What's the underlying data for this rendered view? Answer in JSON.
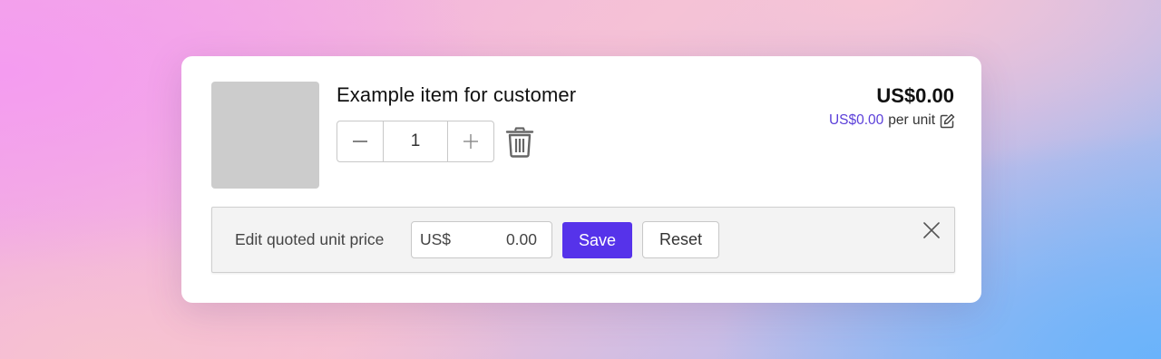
{
  "item": {
    "title": "Example item for customer",
    "quantity": "1",
    "total_price": "US$0.00",
    "unit_price": "US$0.00",
    "unit_suffix": "per unit"
  },
  "edit_panel": {
    "label": "Edit quoted unit price",
    "currency_prefix": "US$",
    "input_value": "0.00",
    "save_label": "Save",
    "reset_label": "Reset"
  },
  "icons": {
    "decrement": "minus-icon",
    "increment": "plus-icon",
    "delete": "trash-icon",
    "edit": "edit-pencil-icon",
    "close": "close-icon"
  },
  "colors": {
    "accent": "#5633ea",
    "unit_price_text": "#5b3fd9",
    "thumbnail_placeholder": "#cccccc"
  }
}
